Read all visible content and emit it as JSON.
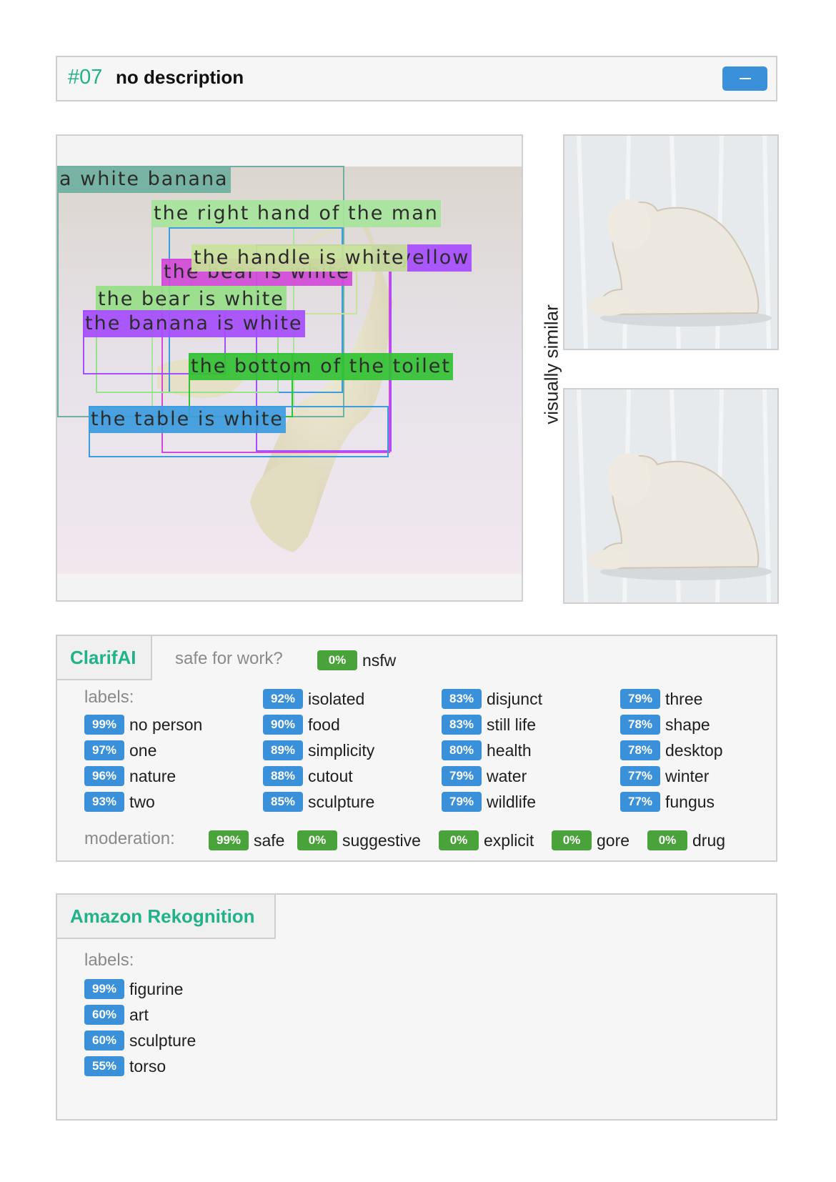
{
  "header": {
    "number": "#07",
    "description": "no description",
    "collapse_icon": "minus-icon"
  },
  "detections": [
    {
      "label": "a white banana",
      "color": "#6fb0a0"
    },
    {
      "label": "the right hand of the man",
      "color": "#a7e59d"
    },
    {
      "label": "the handle is white",
      "color": "#c9e29a"
    },
    {
      "label": "is yellow",
      "color": "#a64dff"
    },
    {
      "label": "the bear is white",
      "color": "#d24ad8"
    },
    {
      "label": "the bear is white",
      "color": "#98e089"
    },
    {
      "label": "the banana is white",
      "color": "#a64dff"
    },
    {
      "label": "the bottom of the toilet",
      "color": "#33c233"
    },
    {
      "label": "the table is white",
      "color": "#3c9dde"
    }
  ],
  "similar": {
    "label": "visually similar"
  },
  "clarifai": {
    "name": "ClarifAI",
    "sfw_question": "safe for work?",
    "nsfw": {
      "pct": "0%",
      "label": "nsfw"
    },
    "labels_title": "labels:",
    "labels": [
      {
        "pct": "99%",
        "label": "no person"
      },
      {
        "pct": "97%",
        "label": "one"
      },
      {
        "pct": "96%",
        "label": "nature"
      },
      {
        "pct": "93%",
        "label": "two"
      },
      {
        "pct": "92%",
        "label": "isolated"
      },
      {
        "pct": "90%",
        "label": "food"
      },
      {
        "pct": "89%",
        "label": "simplicity"
      },
      {
        "pct": "88%",
        "label": "cutout"
      },
      {
        "pct": "85%",
        "label": "sculpture"
      },
      {
        "pct": "83%",
        "label": "disjunct"
      },
      {
        "pct": "83%",
        "label": "still life"
      },
      {
        "pct": "80%",
        "label": "health"
      },
      {
        "pct": "79%",
        "label": "water"
      },
      {
        "pct": "79%",
        "label": "wildlife"
      },
      {
        "pct": "79%",
        "label": "three"
      },
      {
        "pct": "78%",
        "label": "shape"
      },
      {
        "pct": "78%",
        "label": "desktop"
      },
      {
        "pct": "77%",
        "label": "winter"
      },
      {
        "pct": "77%",
        "label": "fungus"
      }
    ],
    "moderation_title": "moderation:",
    "moderation": [
      {
        "pct": "99%",
        "label": "safe"
      },
      {
        "pct": "0%",
        "label": "suggestive"
      },
      {
        "pct": "0%",
        "label": "explicit"
      },
      {
        "pct": "0%",
        "label": "gore"
      },
      {
        "pct": "0%",
        "label": "drug"
      }
    ]
  },
  "rekognition": {
    "name": "Amazon Rekognition",
    "labels_title": "labels:",
    "labels": [
      {
        "pct": "99%",
        "label": "figurine"
      },
      {
        "pct": "60%",
        "label": "art"
      },
      {
        "pct": "60%",
        "label": "sculpture"
      },
      {
        "pct": "55%",
        "label": "torso"
      }
    ]
  }
}
